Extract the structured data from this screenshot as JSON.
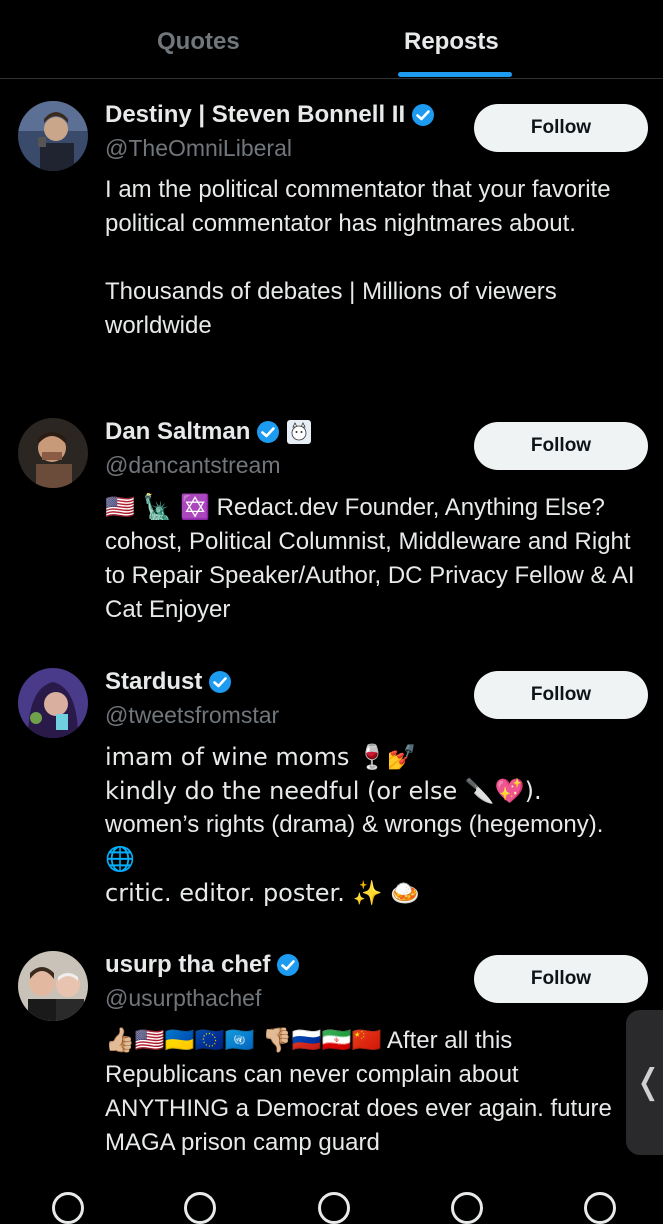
{
  "tabs": {
    "quotes": "Quotes",
    "reposts": "Reposts",
    "active": "reposts"
  },
  "users": [
    {
      "name": "Destiny | Steven Bonnell II",
      "handle": "@TheOmniLiberal",
      "bio_lines": [
        "I am the political commentator that your favorite political commentator has nightmares about.",
        "",
        "Thousands of debates | Millions of viewers worldwide"
      ],
      "follow_label": "Follow",
      "verified": true
    },
    {
      "name": "Dan Saltman",
      "name_suffix_icon": "cat-sticker-icon",
      "handle": "@dancantstream",
      "bio_prefix": "🇺🇸 🗽 ✡️",
      "bio": "Redact.dev Founder, Anything Else? cohost, Political Columnist, Middleware and Right to Repair Speaker/Author, DC Privacy Fellow & AI Cat Enjoyer",
      "follow_label": "Follow",
      "verified": true
    },
    {
      "name": "Stardust",
      "handle": "@tweetsfromstar",
      "bio_lines": [
        "imam of wine moms 🍷💅",
        "kindly do the needful (or else 🔪💖).",
        "women’s rights (drama) & wrongs (hegemony).",
        "🌐",
        "critic. editor. poster. ✨ 🍛"
      ],
      "follow_label": "Follow",
      "verified": true
    },
    {
      "name": "usurp tha chef",
      "handle": "@usurpthachef",
      "bio_prefix": "👍🏼🇺🇸🇺🇦🇪🇺🇺🇳 👎🏼🇷🇺🇮🇷🇨🇳",
      "bio": "After all this Republicans can never complain about ANYTHING a Democrat does ever again. future MAGA prison camp guard",
      "follow_label": "Follow",
      "verified": true
    }
  ],
  "side_handle_glyph": "❬",
  "colors": {
    "background": "#000000",
    "accent": "#1d9bf0",
    "verified": "#1d9bf0",
    "muted": "#71767b",
    "button_bg": "#eff3f4"
  }
}
